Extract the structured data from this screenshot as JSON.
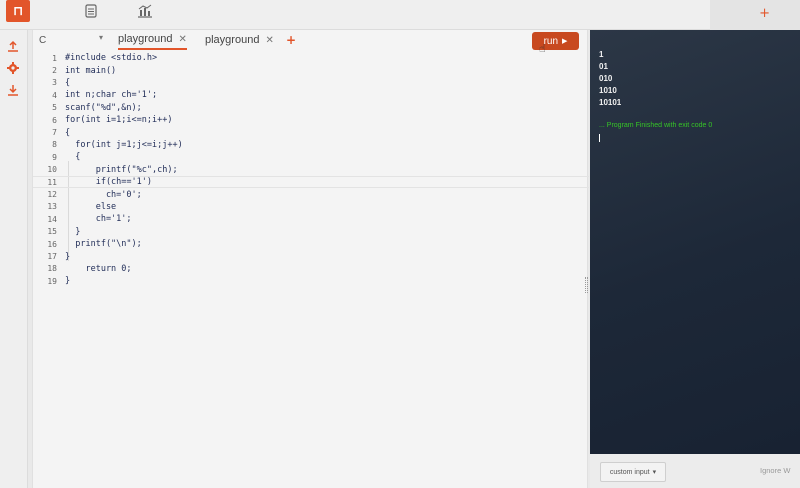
{
  "topbar": {
    "logo_glyph": "⊓",
    "icons": [
      "document-icon",
      "chart-icon"
    ],
    "add_glyph": "+"
  },
  "rail": {
    "icons": [
      "upload-icon",
      "gear-icon",
      "download-icon"
    ]
  },
  "editor": {
    "language": "C",
    "tabs": [
      {
        "label": "playground",
        "close": "✕",
        "active": true
      },
      {
        "label": "playground",
        "close": "✕",
        "active": false
      }
    ],
    "add_tab": "+",
    "run_label": "run",
    "run_arrow": "▶",
    "current_line": 11,
    "lines": [
      {
        "n": "1",
        "text": "#include <stdio.h>"
      },
      {
        "n": "2",
        "text": "int main()"
      },
      {
        "n": "3",
        "text": "{"
      },
      {
        "n": "4",
        "text": "int n;char ch='1';"
      },
      {
        "n": "5",
        "text": "scanf(\"%d\",&n);"
      },
      {
        "n": "6",
        "text": "for(int i=1;i<=n;i++)"
      },
      {
        "n": "7",
        "text": "{"
      },
      {
        "n": "8",
        "text": "  for(int j=1;j<=i;j++)"
      },
      {
        "n": "9",
        "text": "  {"
      },
      {
        "n": "10",
        "text": "      printf(\"%c\",ch);"
      },
      {
        "n": "11",
        "text": "      if(ch=='1')"
      },
      {
        "n": "12",
        "text": "        ch='0';"
      },
      {
        "n": "13",
        "text": "      else"
      },
      {
        "n": "14",
        "text": "      ch='1';"
      },
      {
        "n": "15",
        "text": "  }"
      },
      {
        "n": "16",
        "text": "  printf(\"\\n\");"
      },
      {
        "n": "17",
        "text": "}"
      },
      {
        "n": "18",
        "text": "    return 0;"
      },
      {
        "n": "19",
        "text": "}"
      }
    ]
  },
  "output": {
    "lines": [
      "1",
      "01",
      "010",
      "1010",
      "10101"
    ],
    "status": "... Program Finished with exit code 0",
    "custom_input_label": "custom input",
    "custom_input_arrow": "▾",
    "ignore_text": "Ignore W"
  }
}
